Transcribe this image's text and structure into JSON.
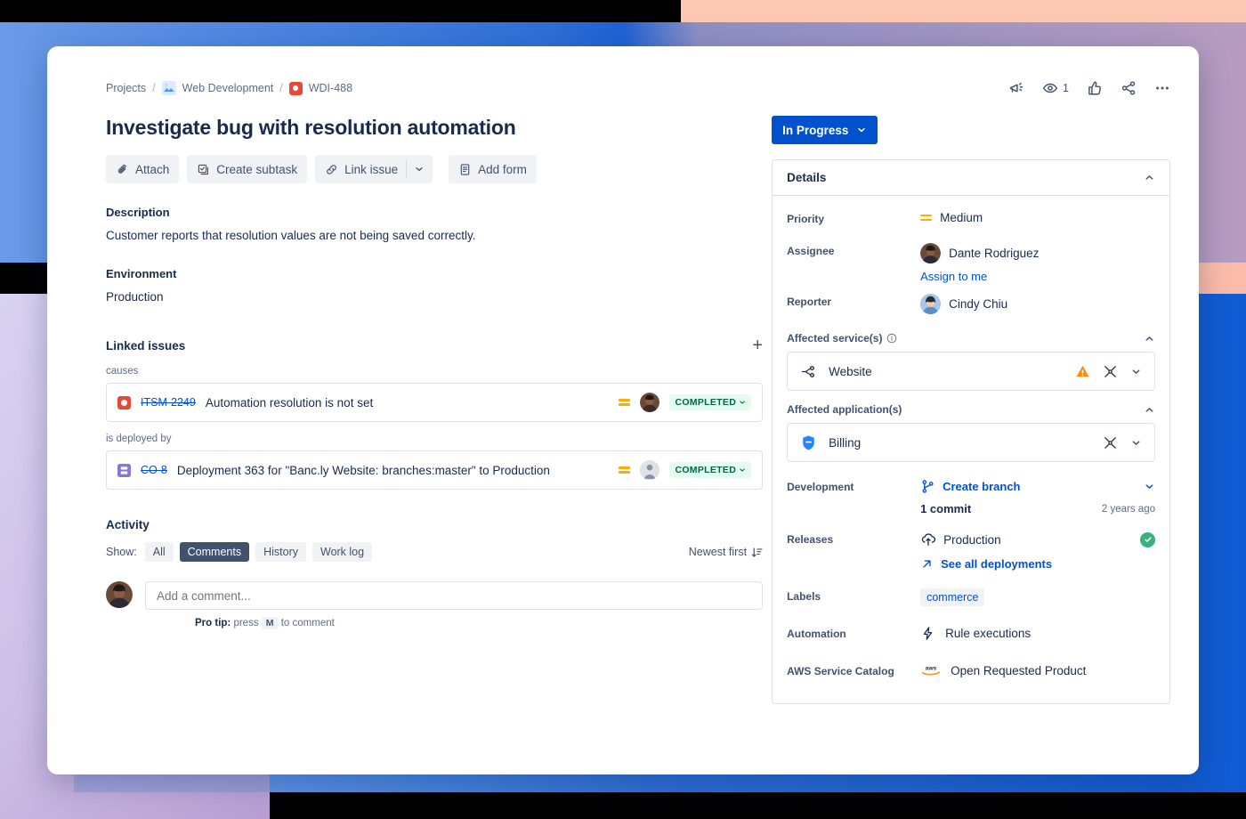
{
  "breadcrumb": {
    "projects": "Projects",
    "project": "Web Development",
    "issue_key": "WDI-488",
    "separator": "/"
  },
  "header_actions": {
    "feedback": "give-feedback",
    "watch_count": "1",
    "like": "like",
    "share": "share",
    "more": "more-actions"
  },
  "issue": {
    "title": "Investigate bug with resolution automation",
    "toolbar": {
      "attach": "Attach",
      "create_subtask": "Create subtask",
      "link_issue": "Link issue",
      "link_caret": "∨",
      "add_form": "Add form"
    },
    "description_heading": "Description",
    "description_body": "Customer reports that resolution values are not being saved correctly.",
    "environment_heading": "Environment",
    "environment_body": "Production"
  },
  "linked_issues": {
    "heading": "Linked issues",
    "add_label": "+",
    "groups": [
      {
        "relation": "causes",
        "items": [
          {
            "icon": "bug-icon",
            "key": "ITSM-2249",
            "summary": "Automation resolution is not set",
            "priority": "Medium",
            "assignee": "Dante Rodriguez",
            "status": "COMPLETED"
          }
        ]
      },
      {
        "relation": "is deployed by",
        "items": [
          {
            "icon": "deployment-icon",
            "key": "CO-8",
            "summary": "Deployment 363 for \"Banc.ly Website: branches:master\" to Production",
            "priority": "Medium",
            "assignee": "unassigned",
            "status": "COMPLETED"
          }
        ]
      }
    ]
  },
  "activity": {
    "heading": "Activity",
    "show_label": "Show:",
    "filters": [
      {
        "label": "All",
        "active": false
      },
      {
        "label": "Comments",
        "active": true
      },
      {
        "label": "History",
        "active": false
      },
      {
        "label": "Work log",
        "active": false
      }
    ],
    "sort": "Newest first",
    "comment_placeholder": "Add a comment...",
    "protip_prefix": "Pro tip:",
    "protip_press": "press",
    "protip_key": "M",
    "protip_suffix": "to comment"
  },
  "sidebar": {
    "status": "In Progress",
    "details_panel": {
      "title": "Details",
      "fields": {
        "priority_label": "Priority",
        "priority_value": "Medium",
        "assignee_label": "Assignee",
        "assignee_value": "Dante Rodriguez",
        "assign_to_me": "Assign to me",
        "reporter_label": "Reporter",
        "reporter_value": "Cindy Chiu",
        "development_label": "Development",
        "development_action": "Create branch",
        "commits": "1 commit",
        "commits_time": "2 years ago",
        "releases_label": "Releases",
        "releases_value": "Production",
        "see_all_deployments": "See all deployments",
        "labels_label": "Labels",
        "labels_value": "commerce",
        "automation_label": "Automation",
        "automation_value": "Rule executions",
        "aws_label": "AWS Service Catalog",
        "aws_value": "Open Requested Product"
      },
      "affected_services": {
        "heading": "Affected service(s)",
        "item": "Website"
      },
      "affected_applications": {
        "heading": "Affected application(s)",
        "item": "Billing"
      }
    }
  },
  "colors": {
    "brand_blue": "#0052cc",
    "link_blue": "#0052cc",
    "priority_medium": "#ffab00",
    "status_done_bg": "#e3fcef",
    "status_done_fg": "#006644",
    "warning": "#ff8b00",
    "success_green": "#36b37e",
    "bug_red": "#e5493a",
    "deployment_purple": "#8777d9"
  }
}
